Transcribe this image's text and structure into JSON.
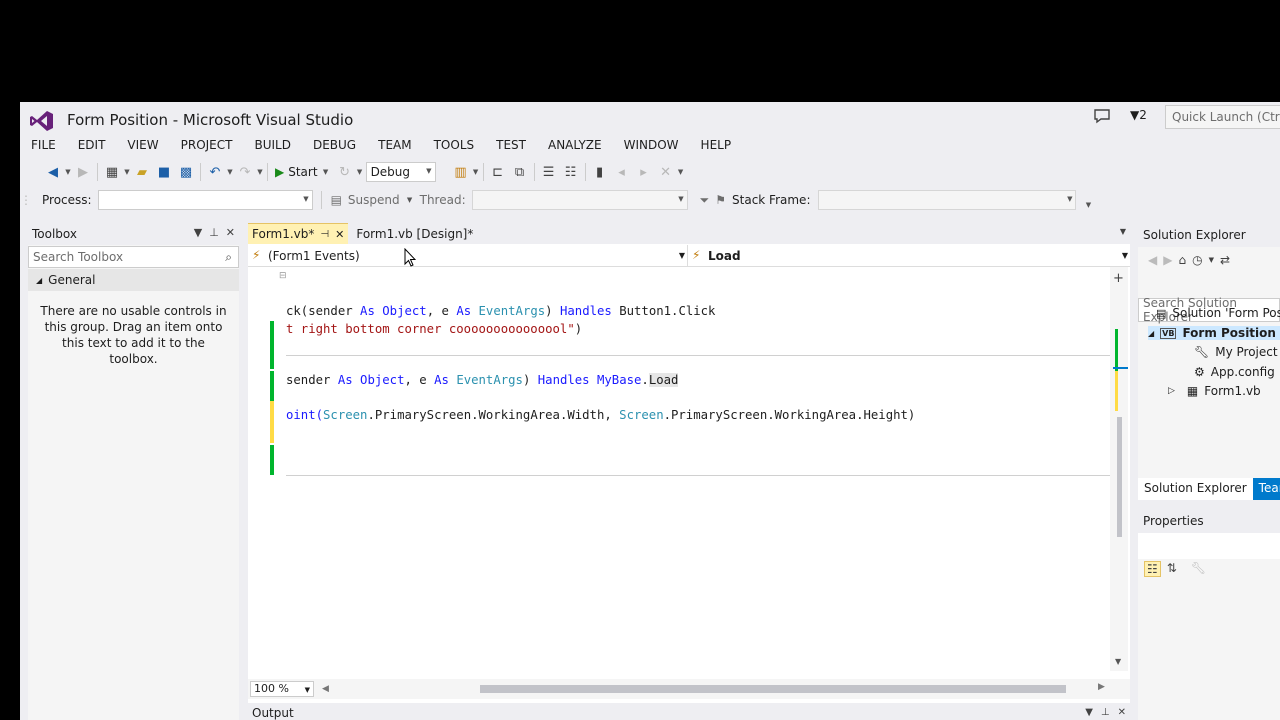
{
  "window": {
    "title": "Form Position - Microsoft Visual Studio",
    "notification_count": "2",
    "quick_launch_placeholder": "Quick Launch (Ctrl+Q)"
  },
  "menu": [
    "FILE",
    "EDIT",
    "VIEW",
    "PROJECT",
    "BUILD",
    "DEBUG",
    "TEAM",
    "TOOLS",
    "TEST",
    "ANALYZE",
    "WINDOW",
    "HELP"
  ],
  "toolbar": {
    "start_label": "Start",
    "config_value": "Debug"
  },
  "debug_location": {
    "process_label": "Process:",
    "process_value": "",
    "suspend_label": "Suspend",
    "thread_label": "Thread:",
    "stack_frame_label": "Stack Frame:"
  },
  "toolbox": {
    "title": "Toolbox",
    "search_placeholder": "Search Toolbox",
    "group": "General",
    "empty_message": "There are no usable controls in this group. Drag an item onto this text to add it to the toolbox."
  },
  "editor": {
    "tabs": [
      {
        "label": "Form1.vb*",
        "active": true
      },
      {
        "label": "Form1.vb [Design]*",
        "active": false
      }
    ],
    "nav_left": "(Form1 Events)",
    "nav_right": "Load",
    "zoom": "100 %",
    "lines": {
      "l1": {
        "p1": "ck(sender ",
        "kw1": "As",
        "sp1": " ",
        "ty1": "Object",
        "p2": ", e ",
        "kw2": "As",
        "sp2": " ",
        "ty2": "EventArgs",
        "p3": ") ",
        "kw3": "Handles",
        "p4": " Button1.Click"
      },
      "l2": {
        "str": "t right bottom corner cooooooooooooool\"",
        "p": ")"
      },
      "l3": {
        "p1": "sender ",
        "kw1": "As",
        "sp1": " ",
        "ty1": "Object",
        "p2": ", e ",
        "kw2": "As",
        "sp2": " ",
        "ty2": "EventArgs",
        "p3": ") ",
        "kw3": "Handles",
        "sp3": " ",
        "kw4": "MyBase",
        "p4": ".",
        "hl": "Load"
      },
      "l4": {
        "p1": "oint(",
        "ty1": "Screen",
        "p2": ".PrimaryScreen.WorkingArea.Width, ",
        "ty2": "Screen",
        "p3": ".PrimaryScreen.WorkingArea.Height)"
      }
    }
  },
  "output": {
    "title": "Output"
  },
  "solution_explorer": {
    "title": "Solution Explorer",
    "search_placeholder": "Search Solution Explorer",
    "items": [
      "Solution 'Form Position'",
      "Form Position",
      "My Project",
      "App.config",
      "Form1.vb"
    ],
    "tabs": [
      "Solution Explorer",
      "Team Explorer"
    ]
  },
  "properties": {
    "title": "Properties"
  },
  "colors": {
    "accent": "#007acc",
    "vs_purple": "#68217a",
    "active_tab": "#fff1b3",
    "saved_change": "#00b52d",
    "unsaved_change": "#ffdb45"
  }
}
